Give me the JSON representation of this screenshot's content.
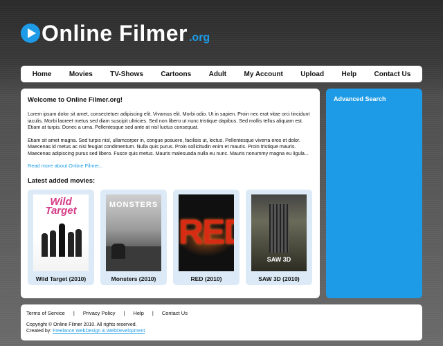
{
  "header": {
    "logo_text": "Online Filmer",
    "logo_tld": ".org"
  },
  "nav": {
    "items": [
      "Home",
      "Movies",
      "TV-Shows",
      "Cartoons",
      "Adult",
      "My Account",
      "Upload",
      "Help",
      "Contact Us"
    ]
  },
  "main": {
    "title": "Welcome to Online Filmer.org!",
    "paragraph1": "Lorem ipsum dolor sit amet, consectetuer adipiscing elit. Vivamus elit. Morbi odio. Ut in sapien. Proin nec erat vitae orci tincidunt iaculis. Morbi laoreet metus sed diam suscipit ultricies. Sed non libero ut nunc tristique dapibus. Sed mollis tellus aliquam est. Etiam at turpis. Donec a urna. Pellentesque sed ante at nisl luctus consequat.",
    "paragraph2": "Etiam sit amet magna. Sed turpis nisl, ullamcorper in, congue posuere, facilisis ut, lectus. Pellentesque viverra eros et dolor. Maecenas id metus ac nisi feugiat condimentum. Nulla quis purus. Proin sollicitudin enim et mauris. Proin tristique mauris. Maecenas adipiscing purus sed libero. Fusce quis metus. Mauris malesuada nulla eu nunc. Mauris nonummy magna eu ligula...",
    "read_more": "Read more about Online Filmer...",
    "latest_heading": "Latest added movies:",
    "movies": [
      {
        "caption": "Wild Target (2010)",
        "poster_title": "Wild Target"
      },
      {
        "caption": "Monsters (2010)",
        "poster_title": "MONSTERS"
      },
      {
        "caption": "RED (2010)",
        "poster_title": "RED"
      },
      {
        "caption": "SAW 3D (2010)",
        "poster_title": "SAW 3D"
      }
    ]
  },
  "sidebar": {
    "title": "Advanced Search"
  },
  "footer": {
    "links": [
      "Terms of Service",
      "Privacy Policy",
      "Help",
      "Contact Us"
    ],
    "separator": "|",
    "copyright": "Copyright © Online Filmer 2010. All rights reserved.",
    "created_by_label": "Created by:",
    "created_by_link": "Freelance WebDesign & WebDevelopment"
  },
  "colors": {
    "accent": "#1e9be6",
    "panel": "#ffffff",
    "movie_card": "#dbeaf6"
  }
}
